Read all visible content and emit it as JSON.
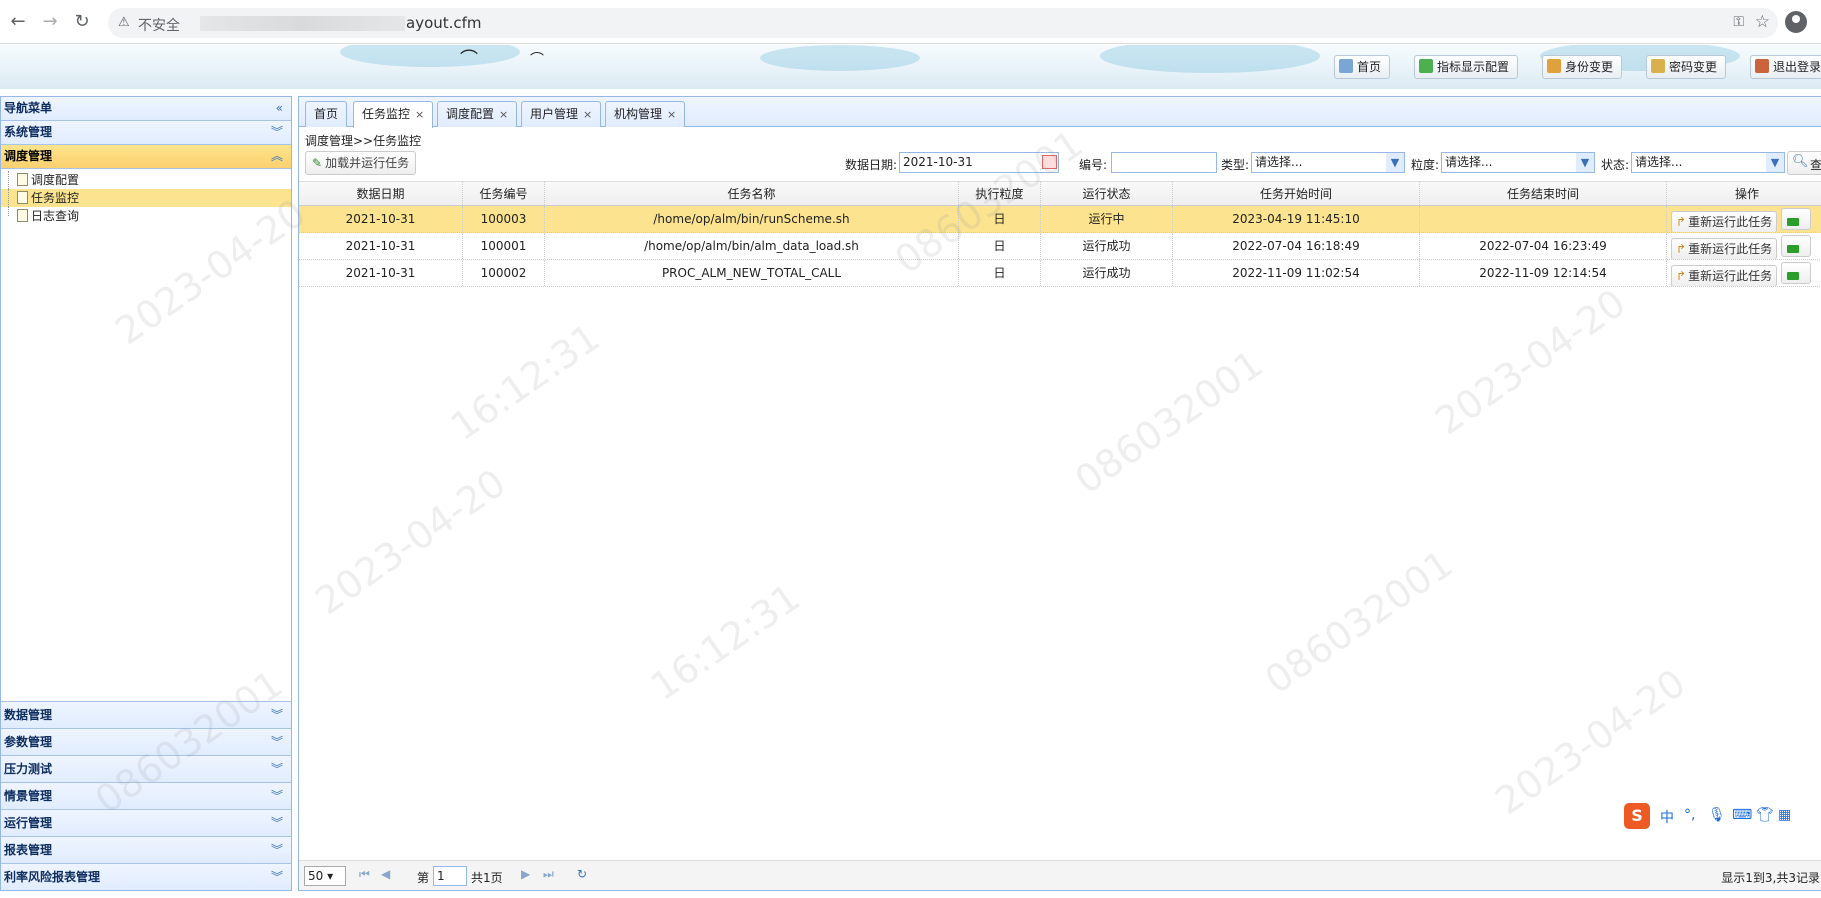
{
  "browser": {
    "insecure_label": "不安全",
    "url_tail": "ayout.cfm"
  },
  "header": {
    "buttons": [
      {
        "label": "首页",
        "icon": "home-icon"
      },
      {
        "label": "指标显示配置",
        "icon": "pencil-icon"
      },
      {
        "label": "身份变更",
        "icon": "user-switch-icon"
      },
      {
        "label": "密码变更",
        "icon": "key-icon"
      },
      {
        "label": "退出登录",
        "icon": "logout-icon"
      }
    ]
  },
  "sidebar": {
    "title": "导航菜单",
    "collapse_icon": "«",
    "sections_top": [
      {
        "label": "系统管理"
      },
      {
        "label": "调度管理",
        "expanded": true
      }
    ],
    "tree": [
      {
        "label": "调度配置"
      },
      {
        "label": "任务监控",
        "selected": true
      },
      {
        "label": "日志查询"
      }
    ],
    "sections_bottom": [
      {
        "label": "数据管理"
      },
      {
        "label": "参数管理"
      },
      {
        "label": "压力测试"
      },
      {
        "label": "情景管理"
      },
      {
        "label": "运行管理"
      },
      {
        "label": "报表管理"
      },
      {
        "label": "利率风险报表管理"
      }
    ]
  },
  "tabs": [
    {
      "label": "首页",
      "closable": false
    },
    {
      "label": "任务监控",
      "closable": true,
      "active": true
    },
    {
      "label": "调度配置",
      "closable": true
    },
    {
      "label": "用户管理",
      "closable": true
    },
    {
      "label": "机构管理",
      "closable": true
    }
  ],
  "breadcrumb": "调度管理>>任务监控",
  "toolbar": {
    "load_run_label": "加载并运行任务"
  },
  "filters": {
    "date_label": "数据日期:",
    "date_value": "2021-10-31",
    "code_label": "编号:",
    "code_value": "",
    "type_label": "类型:",
    "type_value": "请选择...",
    "granularity_label": "粒度:",
    "granularity_value": "请选择...",
    "status_label": "状态:",
    "status_value": "请选择...",
    "search_label": "查"
  },
  "grid": {
    "columns": [
      "数据日期",
      "任务编号",
      "任务名称",
      "执行粒度",
      "运行状态",
      "任务开始时间",
      "任务结束时间",
      "操作"
    ],
    "rows": [
      {
        "date": "2021-10-31",
        "id": "100003",
        "name": "/home/op/alm/bin/runScheme.sh",
        "granularity": "日",
        "status": "运行中",
        "start": "2023-04-19 11:45:10",
        "end": "",
        "selected": true
      },
      {
        "date": "2021-10-31",
        "id": "100001",
        "name": "/home/op/alm/bin/alm_data_load.sh",
        "granularity": "日",
        "status": "运行成功",
        "start": "2022-07-04 16:18:49",
        "end": "2022-07-04 16:23:49"
      },
      {
        "date": "2021-10-31",
        "id": "100002",
        "name": "PROC_ALM_NEW_TOTAL_CALL",
        "granularity": "日",
        "status": "运行成功",
        "start": "2022-11-09 11:02:54",
        "end": "2022-11-09 12:14:54"
      }
    ],
    "rerun_label": "重新运行此任务"
  },
  "pager": {
    "page_size": "50",
    "page_prefix": "第",
    "page_value": "1",
    "page_total": "共1页",
    "info": "显示1到3,共3记录"
  },
  "ime": {
    "logo": "S",
    "lang": "中"
  },
  "watermark": {
    "date": "2023-04-20",
    "time": "16:12:31",
    "id": "086032001"
  }
}
